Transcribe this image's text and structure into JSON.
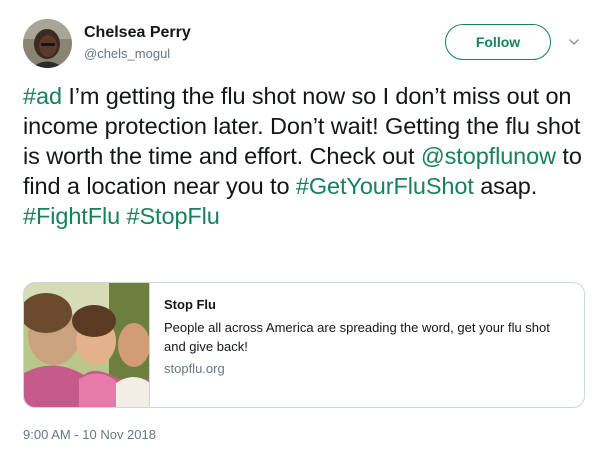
{
  "author": {
    "name": "Chelsea Perry",
    "handle": "@chels_mogul"
  },
  "follow_label": "Follow",
  "tweet": {
    "tag_ad": "#ad",
    "text_1": " I’m getting the flu shot now so I don’t miss out on income protection later. Don’t wait! Getting the flu shot is worth the time and effort. Check out ",
    "mention": "@stopflunow",
    "text_2": " to find a location near you to ",
    "tag_getyourflushot": "#GetYourFluShot",
    "text_3": " asap. ",
    "tag_fightflu": "#FightFlu",
    "text_4": " ",
    "tag_stopflu": "#StopFlu"
  },
  "card": {
    "title": "Stop Flu",
    "description": "People all across America are spreading the word, get your flu shot and give back!",
    "domain": "stopflu.org"
  },
  "timestamp": "9:00 AM - 10 Nov 2018",
  "colors": {
    "link": "#17815a",
    "secondary_text": "#657786",
    "border": "#ccd6dd"
  }
}
